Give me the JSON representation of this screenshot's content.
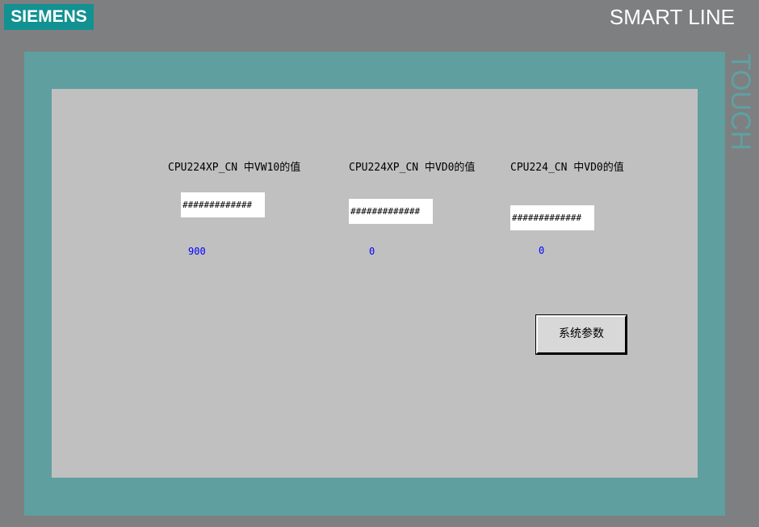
{
  "header": {
    "logo_text": "SIEMENS",
    "product_line": "SMART LINE",
    "touch_label": "TOUCH"
  },
  "colors": {
    "frame": "#7e7f80",
    "bezel": "#5f9f9f",
    "screen": "#c0c0c0",
    "logo_bg": "#129192",
    "value_text": "#0000ff"
  },
  "screen": {
    "fields": [
      {
        "label": "CPU224XP_CN 中VW10的值",
        "io_display": "#############",
        "value": "900"
      },
      {
        "label": "CPU224XP_CN 中VD0的值",
        "io_display": "#############",
        "value": "0"
      },
      {
        "label": "CPU224_CN 中VD0的值",
        "io_display": "#############",
        "value": "0"
      }
    ],
    "system_button_label": "系统参数"
  }
}
